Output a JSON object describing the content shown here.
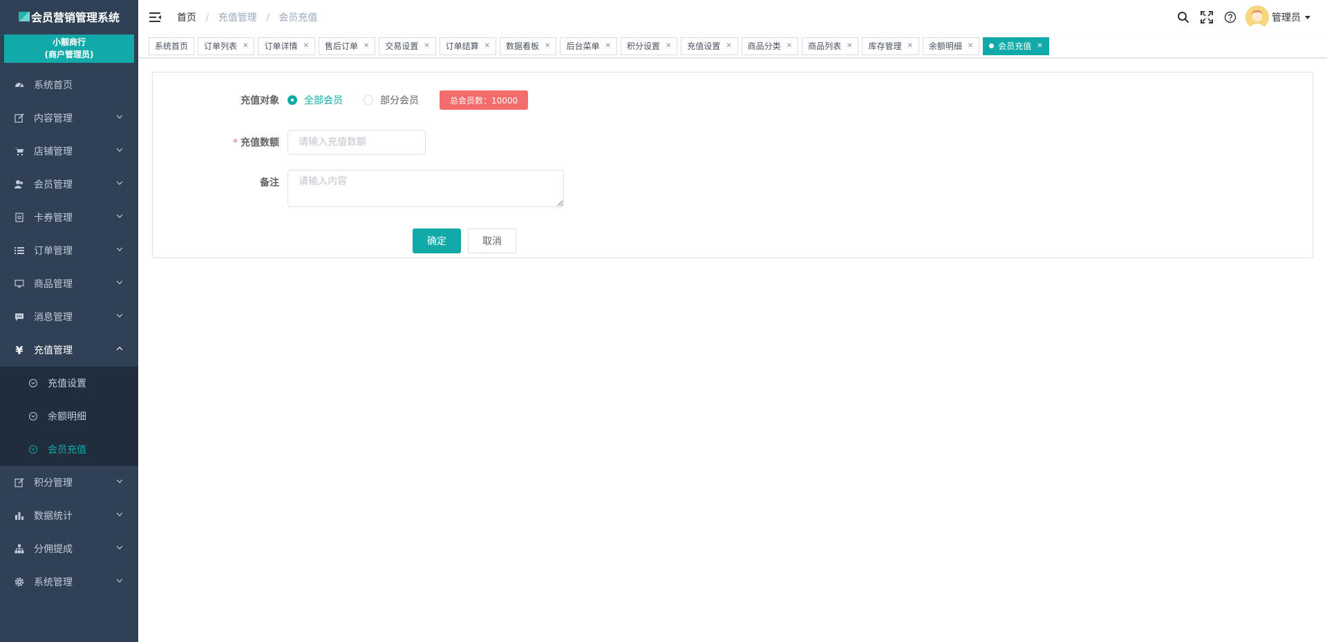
{
  "app": {
    "title": "会员营销管理系统",
    "shop_name": "小靓商行",
    "shop_role": "(商户管理员)"
  },
  "sidebar": {
    "items": [
      {
        "label": "系统首页",
        "icon": "dashboard-icon"
      },
      {
        "label": "内容管理",
        "icon": "edit-icon"
      },
      {
        "label": "店铺管理",
        "icon": "cart-icon"
      },
      {
        "label": "会员管理",
        "icon": "users-icon"
      },
      {
        "label": "卡券管理",
        "icon": "coupon-icon"
      },
      {
        "label": "订单管理",
        "icon": "list-icon"
      },
      {
        "label": "商品管理",
        "icon": "monitor-icon"
      },
      {
        "label": "消息管理",
        "icon": "message-icon"
      },
      {
        "label": "充值管理",
        "icon": "yen-icon"
      },
      {
        "label": "积分管理",
        "icon": "edit-icon"
      },
      {
        "label": "数据统计",
        "icon": "bar-chart-icon"
      },
      {
        "label": "分佣提成",
        "icon": "org-icon"
      },
      {
        "label": "系统管理",
        "icon": "gear-icon"
      }
    ],
    "recharge_sub": [
      {
        "label": "充值设置"
      },
      {
        "label": "余额明细"
      },
      {
        "label": "会员充值"
      }
    ]
  },
  "header": {
    "breadcrumb": [
      "首页",
      "充值管理",
      "会员充值"
    ],
    "admin_name": "管理员"
  },
  "tags": [
    {
      "label": "系统首页",
      "closable": false
    },
    {
      "label": "订单列表",
      "closable": true
    },
    {
      "label": "订单详情",
      "closable": true
    },
    {
      "label": "售后订单",
      "closable": true
    },
    {
      "label": "交易设置",
      "closable": true
    },
    {
      "label": "订单结算",
      "closable": true
    },
    {
      "label": "数据看板",
      "closable": true
    },
    {
      "label": "后台菜单",
      "closable": true
    },
    {
      "label": "积分设置",
      "closable": true
    },
    {
      "label": "充值设置",
      "closable": true
    },
    {
      "label": "商品分类",
      "closable": true
    },
    {
      "label": "商品列表",
      "closable": true
    },
    {
      "label": "库存管理",
      "closable": true
    },
    {
      "label": "余额明细",
      "closable": true
    },
    {
      "label": "会员充值",
      "closable": true,
      "active": true
    }
  ],
  "form": {
    "target_label": "充值对象",
    "option_all": "全部会员",
    "option_part": "部分会员",
    "total_badge": "总会员数：10000",
    "amount_label": "充值数额",
    "amount_required_mark": "*",
    "amount_placeholder": "请输入充值数额",
    "amount_value": "",
    "remark_label": "备注",
    "remark_placeholder": "请输入内容",
    "remark_value": "",
    "confirm_label": "确定",
    "cancel_label": "取消"
  },
  "colors": {
    "accent": "#12aaa8",
    "sidebar_bg": "#304156",
    "submenu_bg": "#1f2d3d",
    "badge_bg": "#f56c6c"
  }
}
